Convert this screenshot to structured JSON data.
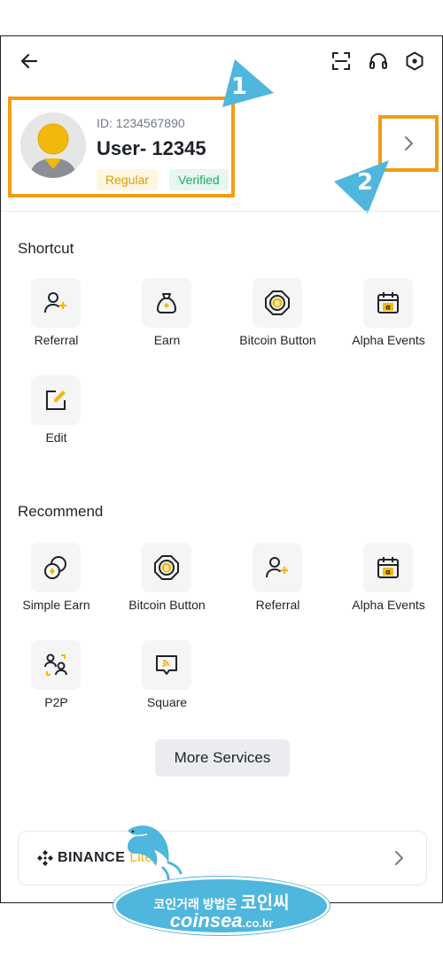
{
  "profile": {
    "id_text": "ID: 1234567890",
    "username_prefix": "User-",
    "username_number": "12345",
    "badge_regular": "Regular",
    "badge_verified": "Verified"
  },
  "callouts": [
    "1",
    "2"
  ],
  "shortcut": {
    "title": "Shortcut",
    "items": [
      {
        "label": "Referral",
        "icon": "referral-icon"
      },
      {
        "label": "Earn",
        "icon": "earn-bag-icon"
      },
      {
        "label": "Bitcoin Button",
        "icon": "bitcoin-button-icon"
      },
      {
        "label": "Alpha Events",
        "icon": "alpha-events-calendar-icon"
      },
      {
        "label": "Edit",
        "icon": "edit-icon"
      }
    ]
  },
  "recommend": {
    "title": "Recommend",
    "items": [
      {
        "label": "Simple Earn",
        "icon": "simple-earn-icon"
      },
      {
        "label": "Bitcoin Button",
        "icon": "bitcoin-button-icon"
      },
      {
        "label": "Referral",
        "icon": "referral-icon"
      },
      {
        "label": "Alpha Events",
        "icon": "alpha-events-calendar-icon"
      },
      {
        "label": "P2P",
        "icon": "p2p-icon"
      },
      {
        "label": "Square",
        "icon": "square-icon"
      }
    ]
  },
  "more_services_label": "More Services",
  "lite": {
    "brand": "BINANCE",
    "suffix": "Lite"
  },
  "watermark": {
    "line1_small": "코인거래 방법은",
    "line1_big": "코인씨",
    "line2_main": "coinsea",
    "line2_tld": ".co.kr"
  },
  "colors": {
    "accent_yellow": "#f0b90b",
    "highlight_orange": "#f39c12",
    "callout_blue": "#4fb6dd",
    "verified_green": "#23a868"
  }
}
